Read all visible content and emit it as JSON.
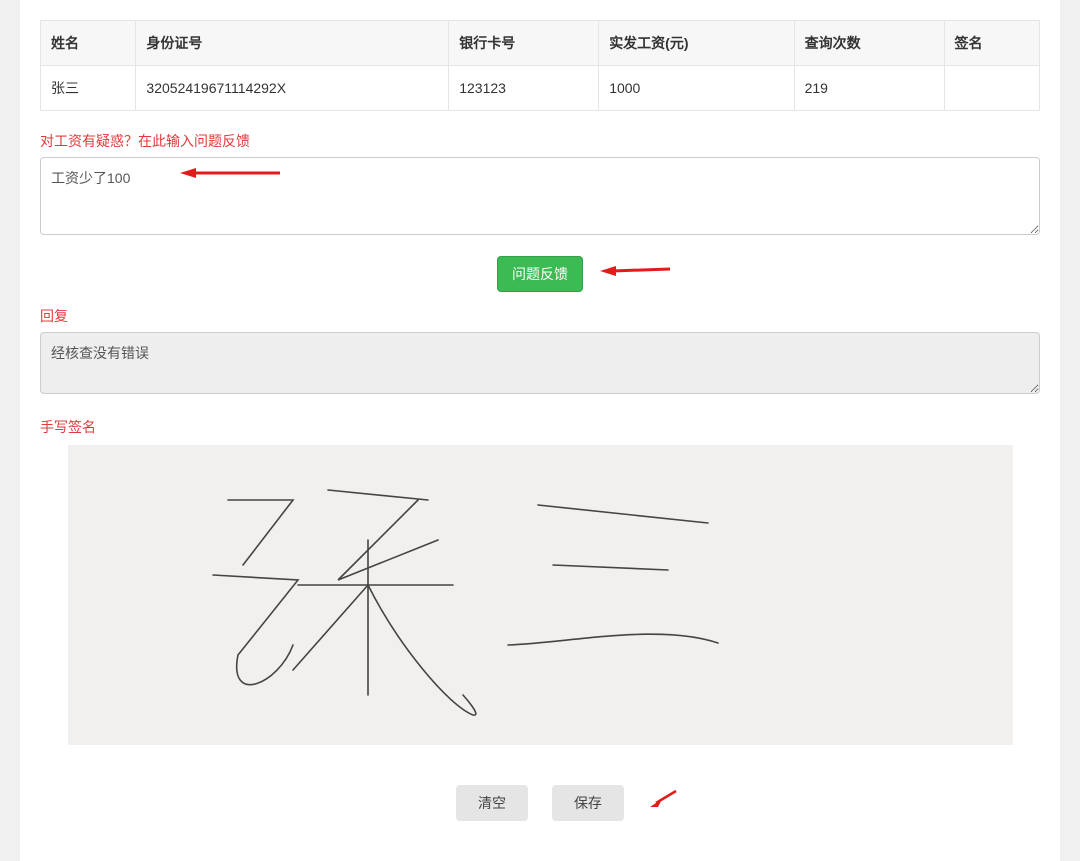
{
  "table": {
    "headers": [
      "姓名",
      "身份证号",
      "银行卡号",
      "实发工资(元)",
      "查询次数",
      "签名"
    ],
    "row": {
      "name": "张三",
      "id_number": "32052419671114292X",
      "bank_card": "123123",
      "salary": "1000",
      "query_count": "219",
      "signature": ""
    }
  },
  "labels": {
    "feedback_prompt": "对工资有疑惑？在此输入问题反馈",
    "reply": "回复",
    "handwritten_signature": "手写签名"
  },
  "feedback": {
    "value": "工资少了100"
  },
  "reply": {
    "value": "经核查没有错误"
  },
  "buttons": {
    "submit_feedback": "问题反馈",
    "clear": "清空",
    "save": "保存"
  }
}
